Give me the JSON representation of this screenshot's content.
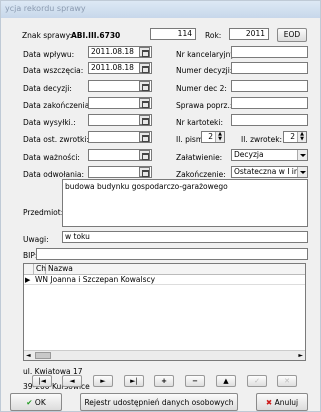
{
  "window": {
    "title": "ycja rekordu sprawy"
  },
  "header": {
    "znak_label": "Znak sprawy:",
    "znak_value": "ABI.III.6730",
    "number": "114",
    "rok_label": "Rok:",
    "rok_value": "2011",
    "eod_button": "EOD"
  },
  "left_fields": [
    {
      "label": "Data wpływu:",
      "value": "2011.08.18"
    },
    {
      "label": "Data wszczęcia:",
      "value": "2011.08.18"
    },
    {
      "label": "Data decyzji:",
      "value": ""
    },
    {
      "label": "Data zakończenia:",
      "value": ""
    },
    {
      "label": "Data wysyłki.:",
      "value": ""
    },
    {
      "label": "Data ost. zwrotki:",
      "value": ""
    },
    {
      "label": "Data ważności:",
      "value": ""
    },
    {
      "label": "Data odwołania:",
      "value": ""
    }
  ],
  "right_fields": {
    "nr_kancelaryjny": "Nr kancelaryjny:",
    "numer_decyzji": "Numer decyzji:",
    "numer_dec2": "Numer dec 2:",
    "sprawa_poprz": "Sprawa poprz.:",
    "nr_kartoteki": "Nr kartoteki:",
    "il_pism_label": "Il. pism:",
    "il_pism_value": "2",
    "il_zwrotek_label": "Il. zwrotek:",
    "il_zwrotek_value": "2",
    "zalatwienie_label": "Załatwienie:",
    "zalatwienie_value": "Decyzja",
    "zakonczenie_label": "Zakończenie:",
    "zakonczenie_value": "Ostateczna w I inst."
  },
  "przedmiot": {
    "label": "Przedmiot:",
    "value": "budowa budynku gospodarczo-garażowego"
  },
  "uwagi": {
    "label": "Uwagi:",
    "value": "w toku"
  },
  "bip": {
    "label": "BIP:",
    "value": ""
  },
  "table": {
    "columns": [
      "Ch",
      "Nazwa"
    ],
    "rows": [
      {
        "ch": "",
        "nazwa": "WN Joanna i Szczepan Kowalscy"
      }
    ]
  },
  "address": {
    "line1": "ul. Kwiatowa 17",
    "line2": "39-200 Kursowice"
  },
  "nav": [
    "|◄",
    "◄",
    "►",
    "►|",
    "+",
    "−",
    "▲",
    "✓",
    "✕"
  ],
  "buttons": {
    "ok": "OK",
    "register": "Rejestr udostępnień danych osobowych",
    "cancel": "Anuluj"
  },
  "colors": {
    "ok_check": "#1f9a1f",
    "cancel_x": "#cc1a1a"
  }
}
